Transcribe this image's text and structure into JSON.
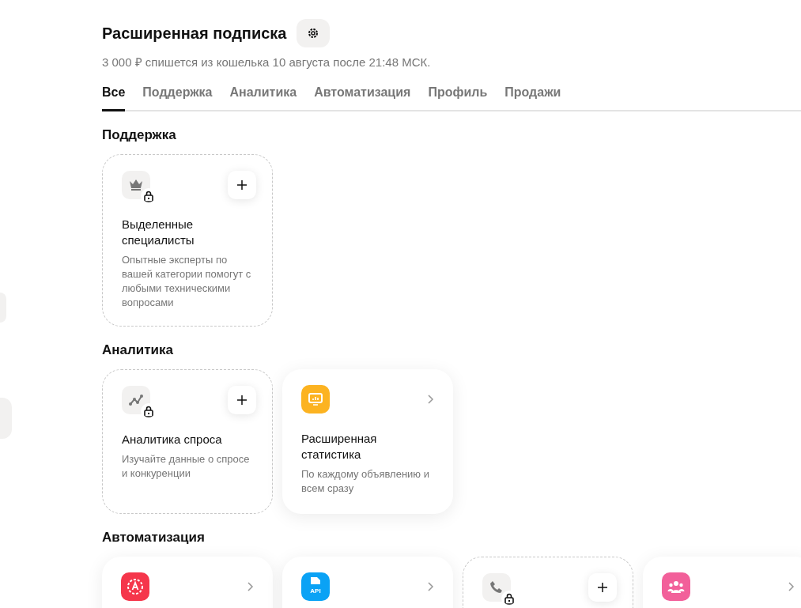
{
  "header": {
    "title": "Расширенная подписка",
    "subtitle": "3 000 ₽ спишется из кошелька 10 августа после 21:48  МСК."
  },
  "tabs": [
    {
      "label": "Все",
      "selected": true
    },
    {
      "label": "Поддержка",
      "selected": false
    },
    {
      "label": "Аналитика",
      "selected": false
    },
    {
      "label": "Автоматизация",
      "selected": false
    },
    {
      "label": "Профиль",
      "selected": false
    },
    {
      "label": "Продажи",
      "selected": false
    }
  ],
  "sections": [
    {
      "title": "Поддержка",
      "cards": [
        {
          "kind": "locked",
          "title": "Выделенные специалисты",
          "description": "Опытные эксперты по вашей категории помогут с любыми техническими вопросами"
        }
      ]
    },
    {
      "title": "Аналитика",
      "cards": [
        {
          "kind": "locked",
          "title": "Аналитика спроса",
          "description": "Изучайте данные о спросе и конкуренции"
        },
        {
          "kind": "link",
          "color": "#fcb321",
          "title": "Расширенная статистика",
          "description": "По каждому объявлению и всем сразу"
        }
      ]
    },
    {
      "title": "Автоматизация",
      "cards": [
        {
          "kind": "link",
          "color": "#f5364b"
        },
        {
          "kind": "link",
          "color": "#0aa2f5",
          "icon_text": "API"
        },
        {
          "kind": "locked"
        },
        {
          "kind": "link",
          "color": "#f2609a"
        }
      ]
    }
  ]
}
